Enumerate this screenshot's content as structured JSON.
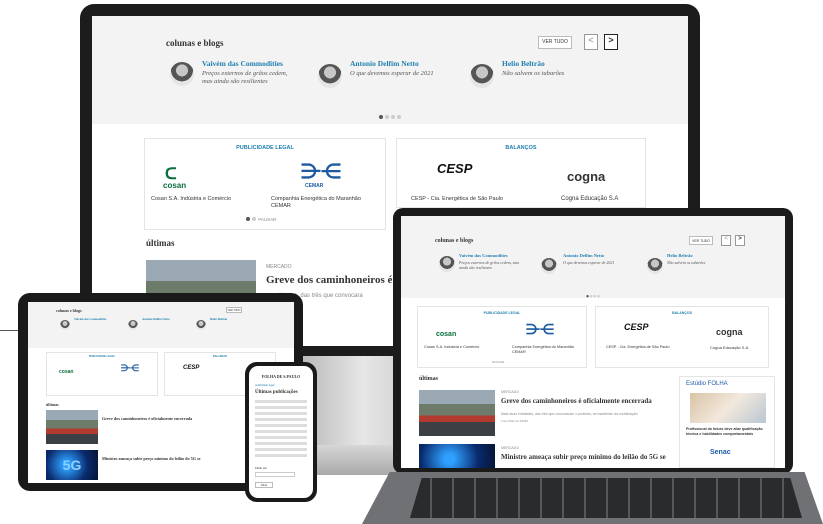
{
  "columns": {
    "title": "colunas e blogs",
    "see_all": "VER TUDO",
    "prev": "<",
    "next": ">",
    "items": [
      {
        "author": "Vaivém das Commodities",
        "headline": "Preços externos de grãos cedem, mas ainda são resilientes"
      },
      {
        "author": "Antonio Delfim Netto",
        "headline": "O que devemos esperar de 2021"
      },
      {
        "author": "Helio Beltrão",
        "headline": "Não salvem os tubarões"
      }
    ]
  },
  "legal": {
    "title": "PUBLICIDADE LEGAL",
    "items": [
      {
        "logo": "cosan",
        "name": "Cosan S.A. Indústria e Comércio"
      },
      {
        "logo": "CEMAR",
        "name": "Companhia Energética do Maranhão CEMAR"
      }
    ],
    "pause": "PAUSAR"
  },
  "balances": {
    "title": "BALANÇOS",
    "items": [
      {
        "logo": "CESP",
        "name": "CESP - Cia. Energética de São Paulo"
      },
      {
        "logo": "cogna",
        "name": "Cogna Educação S.A"
      }
    ]
  },
  "latest": {
    "title": "últimas",
    "items": [
      {
        "section": "MERCADO",
        "headline": "Greve dos caminhoneiros é oficialmente encerrada",
        "summary": "Mais duas entidades, das três que convocaram o protesto, se manteram da mobilização",
        "time": "1.fev.2021 às 23h54"
      },
      {
        "section": "MERCADO",
        "headline": "Ministro ameaça subir preço mínimo do leilão do 5G se",
        "summary": "",
        "time": ""
      }
    ],
    "monitor_headline": "Greve dos caminhoneiros é o",
    "monitor_summary": "...entidades, das três que convocara"
  },
  "ad": {
    "brand": "Estúdio FOLHA",
    "text": "Profissional do futuro deve aliar qualificação técnica e habilidades comportamentais",
    "sponsor": "Senac"
  },
  "phone": {
    "masthead": "FOLHA DE S.PAULO",
    "breadcrumb": "publicidade legal",
    "title": "Últimas publicações",
    "filter_label": "Filtrar por",
    "filter_button": "Filtrar"
  },
  "colors": {
    "accent": "#1f7fb0",
    "green": "#0a6f3c",
    "cemar": "#1d5aa0",
    "senac": "#1f5aa6"
  }
}
